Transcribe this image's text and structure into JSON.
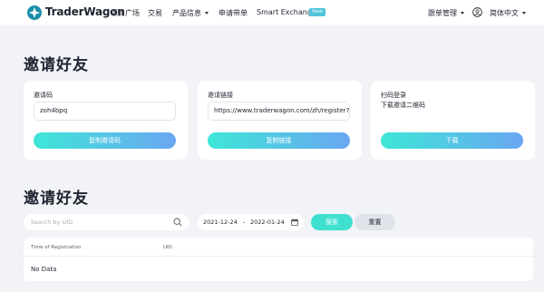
{
  "nav": {
    "brand": "TraderWagon",
    "items": [
      "项目广场",
      "交易",
      "产品信息",
      "申请带单",
      "Smart Exchange"
    ],
    "new_badge": "New",
    "follow_management": "跟单管理",
    "language": "简体中文",
    "icons": [
      "traderwagon-logo-icon",
      "chevron-down-icon",
      "user-icon"
    ]
  },
  "section1": {
    "title": "邀请好友"
  },
  "cards": {
    "code": {
      "label": "邀请码",
      "value": "zoh4bpq",
      "button": "复制邀请码"
    },
    "link": {
      "label": "邀请链接",
      "value": "https://www.traderwagon.com/zh/register?ref=zo",
      "button": "复制链接"
    },
    "qr": {
      "label": "扫码登录",
      "subtitle": "下载邀请二维码",
      "button": "下载"
    }
  },
  "section2": {
    "title": "邀请好友"
  },
  "filters": {
    "search_placeholder": "Search by UID",
    "date_from": "2021-12-24",
    "date_sep": "-",
    "date_to": "2022-01-24",
    "search_button": "搜索",
    "reset_button": "重置",
    "icons": [
      "search-icon",
      "calendar-icon"
    ]
  },
  "table": {
    "columns": [
      "Time of Registration",
      "UID"
    ],
    "empty_text": "No Data"
  },
  "colors": {
    "accent_start": "#3ee6d7",
    "accent_end": "#6aa6f2",
    "search_button": "#3ee0d0",
    "background": "#f2f3f6"
  }
}
